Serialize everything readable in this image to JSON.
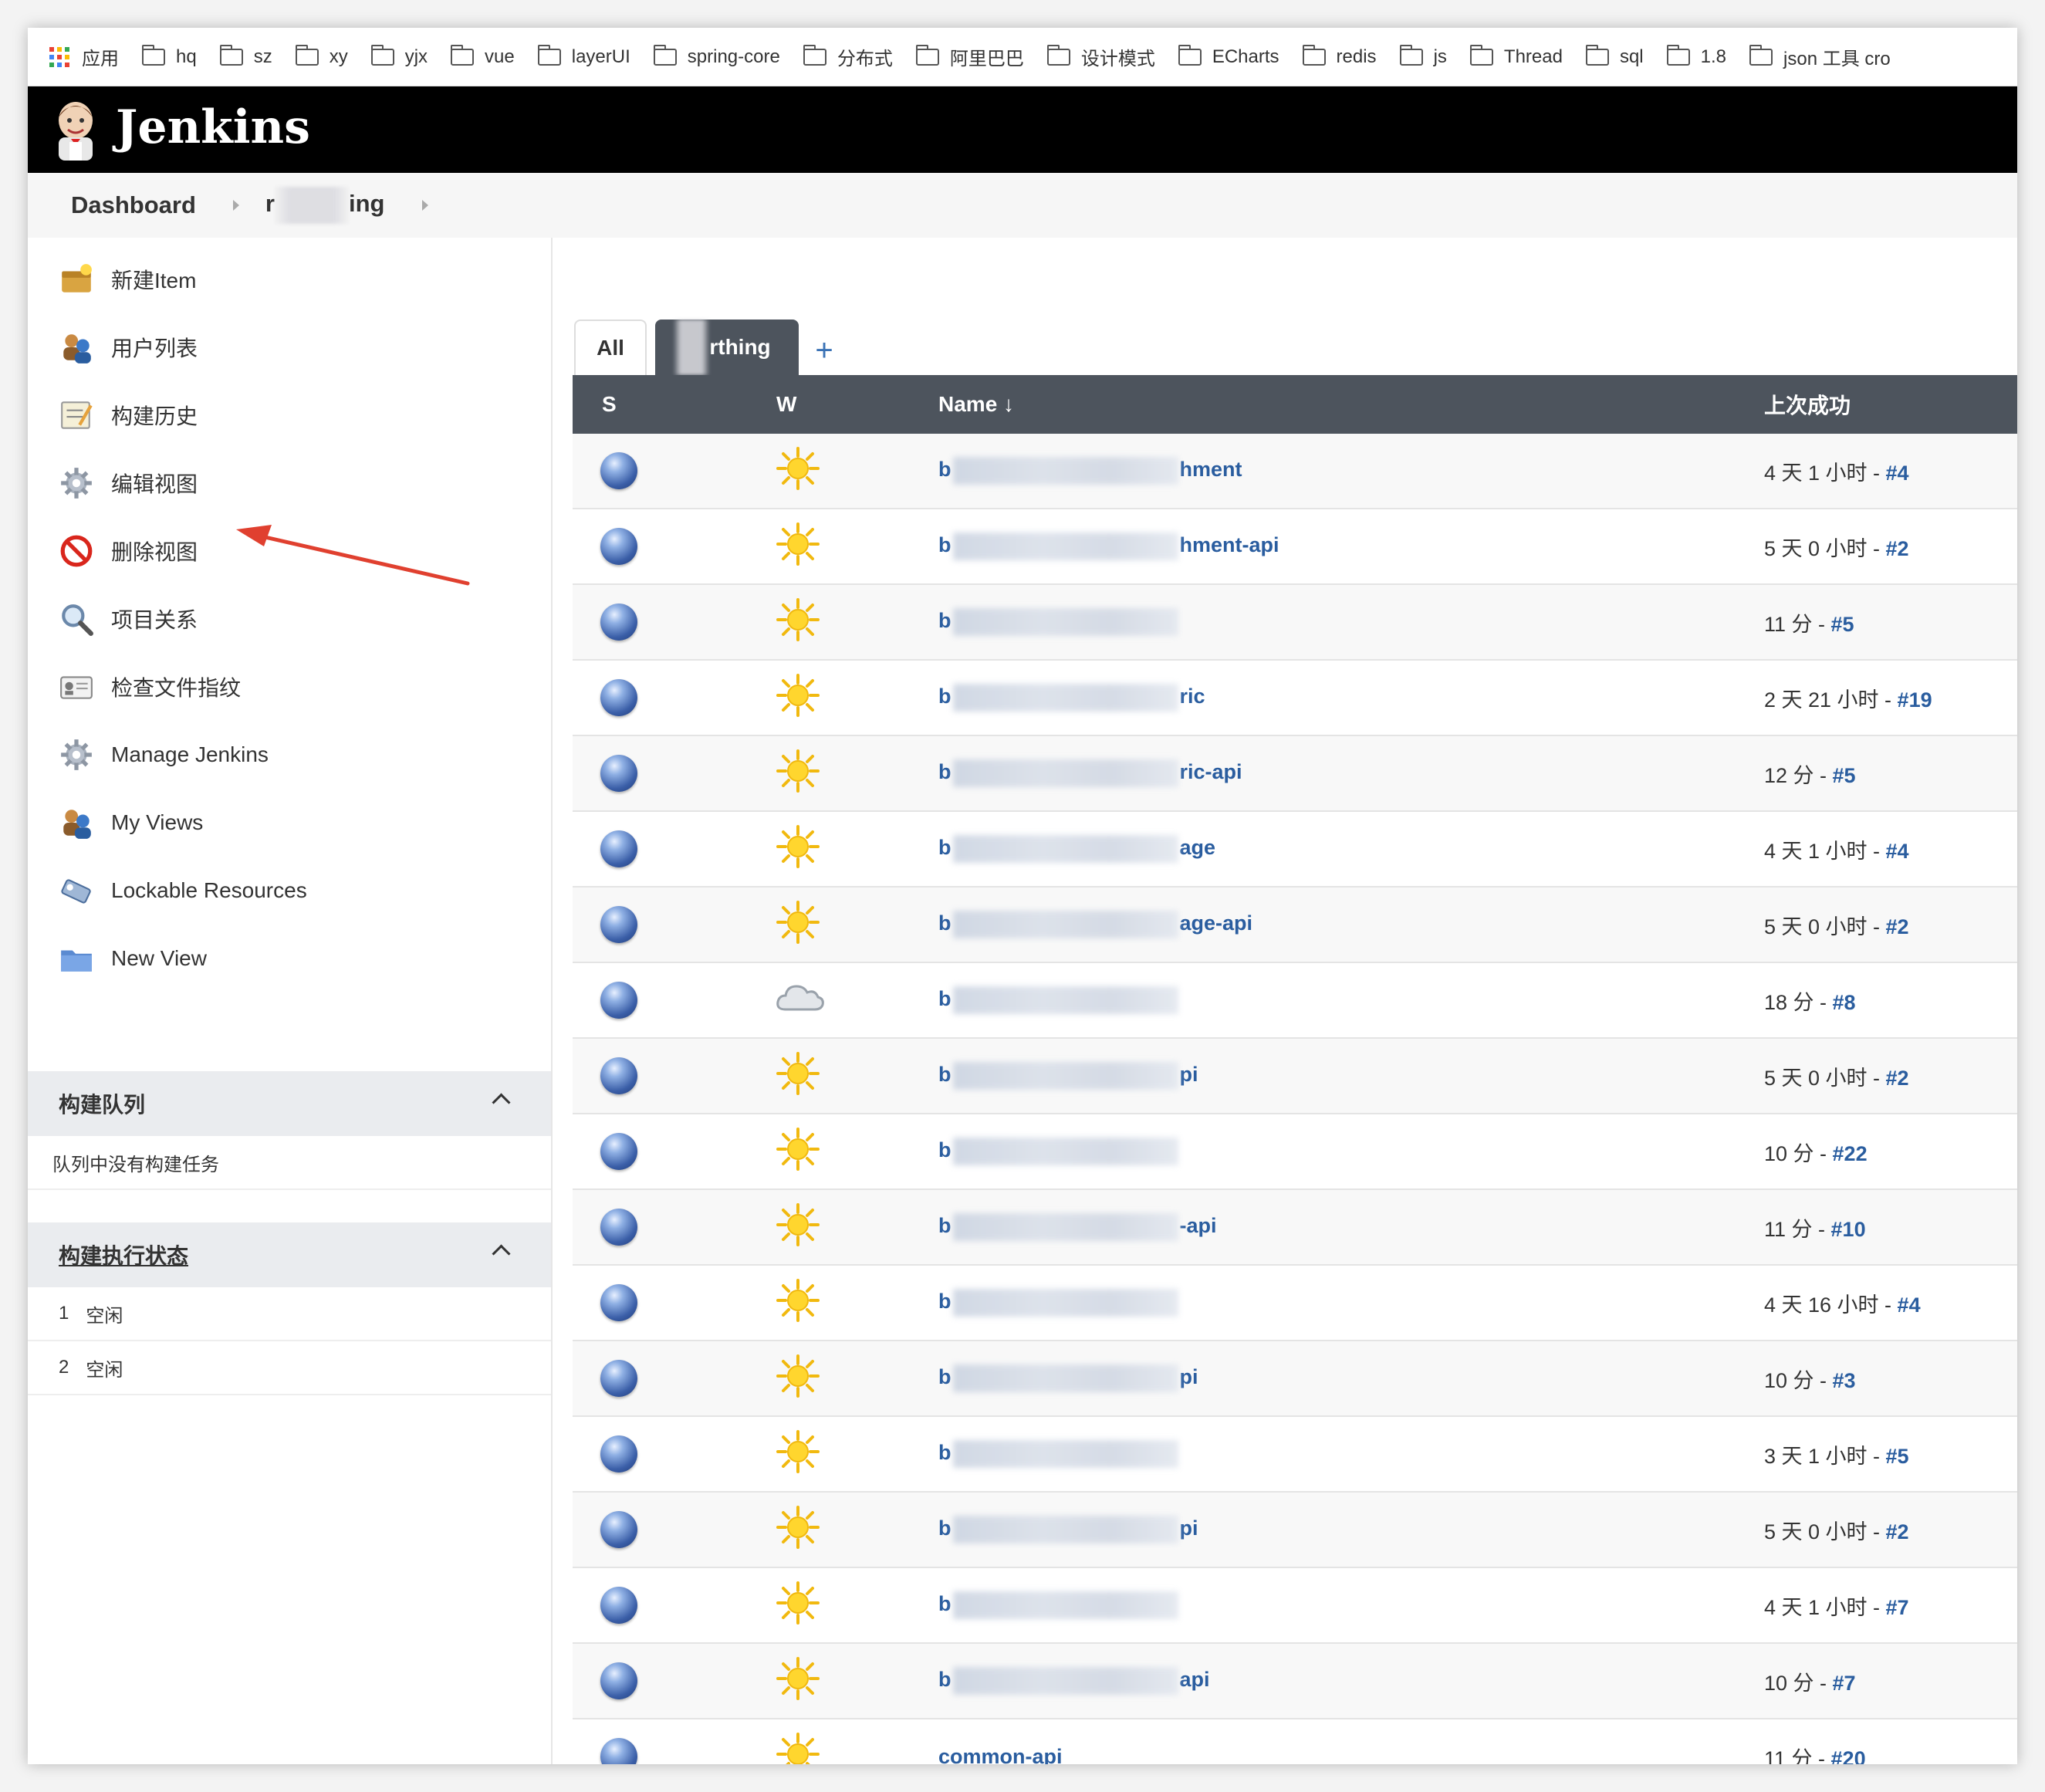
{
  "bookmarks": [
    {
      "label": "应用",
      "icon": "apps-grid-icon"
    },
    {
      "label": "hq",
      "icon": "folder-icon"
    },
    {
      "label": "sz",
      "icon": "folder-icon"
    },
    {
      "label": "xy",
      "icon": "folder-icon"
    },
    {
      "label": "yjx",
      "icon": "folder-icon"
    },
    {
      "label": "vue",
      "icon": "folder-icon"
    },
    {
      "label": "layerUI",
      "icon": "folder-icon"
    },
    {
      "label": "spring-core",
      "icon": "folder-icon"
    },
    {
      "label": "分布式",
      "icon": "folder-icon"
    },
    {
      "label": "阿里巴巴",
      "icon": "folder-icon"
    },
    {
      "label": "设计模式",
      "icon": "folder-icon"
    },
    {
      "label": "ECharts",
      "icon": "folder-icon"
    },
    {
      "label": "redis",
      "icon": "folder-icon"
    },
    {
      "label": "js",
      "icon": "folder-icon"
    },
    {
      "label": "Thread",
      "icon": "folder-icon"
    },
    {
      "label": "sql",
      "icon": "folder-icon"
    },
    {
      "label": "1.8",
      "icon": "folder-icon"
    },
    {
      "label": "json 工具 cro",
      "icon": "folder-icon"
    }
  ],
  "header": {
    "brand": "Jenkins",
    "logo_icon": "jenkins-butler-icon",
    "background": "#000000"
  },
  "breadcrumb": {
    "root": "Dashboard",
    "view_prefix": "r",
    "view_suffix": "ing"
  },
  "sidebar": {
    "tasks": [
      {
        "label": "新建Item",
        "icon": "new-item-icon"
      },
      {
        "label": "用户列表",
        "icon": "users-icon"
      },
      {
        "label": "构建历史",
        "icon": "build-history-icon"
      },
      {
        "label": "编辑视图",
        "icon": "gear-icon"
      },
      {
        "label": "删除视图",
        "icon": "no-entry-icon"
      },
      {
        "label": "项目关系",
        "icon": "magnifier-icon"
      },
      {
        "label": "检查文件指纹",
        "icon": "fingerprint-card-icon"
      },
      {
        "label": "Manage Jenkins",
        "icon": "gear-icon"
      },
      {
        "label": "My Views",
        "icon": "users-icon"
      },
      {
        "label": "Lockable Resources",
        "icon": "key-icon"
      },
      {
        "label": "New View",
        "icon": "folder-icon"
      }
    ],
    "build_queue": {
      "title": "构建队列",
      "empty_text": "队列中没有构建任务"
    },
    "executors": {
      "title": "构建执行状态",
      "items": [
        {
          "num": "1",
          "status": "空闲"
        },
        {
          "num": "2",
          "status": "空闲"
        }
      ]
    }
  },
  "tabs": {
    "all": "All",
    "active": "rthing",
    "add": "+"
  },
  "table": {
    "headers": {
      "s": "S",
      "w": "W",
      "name": "Name ↓",
      "last_success": "上次成功"
    },
    "rows": [
      {
        "name_start": "b",
        "name_end": "hment",
        "weather": "sunny-icon",
        "time": "4 天 1 小时 - ",
        "build": "#4"
      },
      {
        "name_start": "b",
        "name_end": "hment-api",
        "weather": "sunny-icon",
        "time": "5 天 0 小时 - ",
        "build": "#2"
      },
      {
        "name_start": "b",
        "name_end": "",
        "weather": "sunny-icon",
        "time": "11 分 - ",
        "build": "#5"
      },
      {
        "name_start": "b",
        "name_end": "ric",
        "weather": "sunny-icon",
        "time": "2 天 21 小时 - ",
        "build": "#19"
      },
      {
        "name_start": "b",
        "name_end": "ric-api",
        "weather": "sunny-icon",
        "time": "12 分 - ",
        "build": "#5"
      },
      {
        "name_start": "b",
        "name_end": "age",
        "weather": "sunny-icon",
        "time": "4 天 1 小时 - ",
        "build": "#4"
      },
      {
        "name_start": "b",
        "name_end": "age-api",
        "weather": "sunny-icon",
        "time": "5 天 0 小时 - ",
        "build": "#2"
      },
      {
        "name_start": "b",
        "name_end": "",
        "weather": "cloudy-icon",
        "time": "18 分 - ",
        "build": "#8"
      },
      {
        "name_start": "b",
        "name_end": "pi",
        "weather": "sunny-icon",
        "time": "5 天 0 小时 - ",
        "build": "#2"
      },
      {
        "name_start": "b",
        "name_end": "",
        "weather": "sunny-icon",
        "time": "10 分 - ",
        "build": "#22"
      },
      {
        "name_start": "b",
        "name_end": "-api",
        "weather": "sunny-icon",
        "time": "11 分 - ",
        "build": "#10"
      },
      {
        "name_start": "b",
        "name_end": "",
        "weather": "sunny-icon",
        "time": "4 天 16 小时 - ",
        "build": "#4"
      },
      {
        "name_start": "b",
        "name_end": "pi",
        "weather": "sunny-icon",
        "time": "10 分 - ",
        "build": "#3"
      },
      {
        "name_start": "b",
        "name_end": "",
        "weather": "sunny-icon",
        "time": "3 天 1 小时 - ",
        "build": "#5"
      },
      {
        "name_start": "b",
        "name_end": "pi",
        "weather": "sunny-icon",
        "time": "5 天 0 小时 - ",
        "build": "#2"
      },
      {
        "name_start": "b",
        "name_end": "",
        "weather": "sunny-icon",
        "time": "4 天 1 小时 - ",
        "build": "#7"
      },
      {
        "name_start": "b",
        "name_end": "api",
        "weather": "sunny-icon",
        "time": "10 分 - ",
        "build": "#7"
      },
      {
        "name_start": "common-api",
        "name_end": "",
        "weather": "sunny-icon",
        "time": "11 分 - ",
        "build": "#20",
        "unblurred": true
      }
    ]
  },
  "colors": {
    "link": "#2a5d9f",
    "table_header": "#4d545d",
    "annotation_arrow": "#e0402f",
    "status_ball": "#3b5fa8",
    "sun": "#f5c518"
  }
}
